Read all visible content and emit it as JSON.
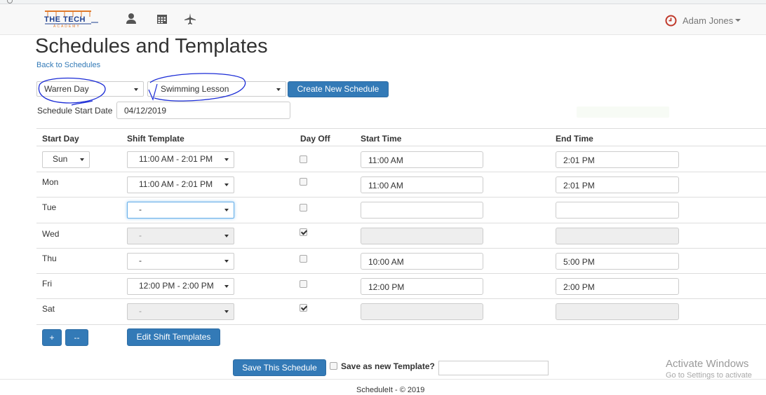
{
  "nav": {
    "logo_text": "THE TECH",
    "logo_sub": "ACADEMY",
    "user_name": "Adam Jones",
    "icons": [
      "user-icon",
      "calendar-icon",
      "airplane-icon",
      "clock-icon"
    ]
  },
  "page": {
    "title": "Schedules and Templates",
    "back_link": "Back to Schedules"
  },
  "controls": {
    "employee_select": "Warren Day",
    "template_select": "Swimming Lesson",
    "create_button": "Create New Schedule",
    "start_date_label": "Schedule Start Date",
    "start_date_value": "04/12/2019"
  },
  "table": {
    "headers": {
      "start_day": "Start Day",
      "shift_template": "Shift Template",
      "day_off": "Day Off",
      "start_time": "Start Time",
      "end_time": "End Time"
    },
    "rows": [
      {
        "day": "Sun",
        "template": "11:00 AM - 2:01 PM",
        "day_off": false,
        "start": "11:00 AM",
        "end": "2:01 PM"
      },
      {
        "day": "Mon",
        "template": "11:00 AM - 2:01 PM",
        "day_off": false,
        "start": "11:00 AM",
        "end": "2:01 PM"
      },
      {
        "day": "Tue",
        "template": "-",
        "day_off": false,
        "start": "",
        "end": ""
      },
      {
        "day": "Wed",
        "template": "-",
        "day_off": true,
        "start": "",
        "end": ""
      },
      {
        "day": "Thu",
        "template": "-",
        "day_off": false,
        "start": "10:00 AM",
        "end": "5:00 PM"
      },
      {
        "day": "Fri",
        "template": "12:00 PM - 2:00 PM",
        "day_off": false,
        "start": "12:00 PM",
        "end": "2:00 PM"
      },
      {
        "day": "Sat",
        "template": "-",
        "day_off": true,
        "start": "",
        "end": ""
      }
    ]
  },
  "actions": {
    "add_label": "+",
    "remove_label": "--",
    "edit_templates": "Edit Shift Templates",
    "save_schedule": "Save This Schedule",
    "save_as_template": "Save as new Template?"
  },
  "footer": {
    "copyright": "ScheduleIt - © 2019"
  },
  "watermark": {
    "line1": "Activate Windows",
    "line2": "Go to Settings to activate"
  },
  "colors": {
    "primary": "#337ab7",
    "annotation_ink": "#1a2bd6",
    "clock_icon": "#c0392b"
  }
}
